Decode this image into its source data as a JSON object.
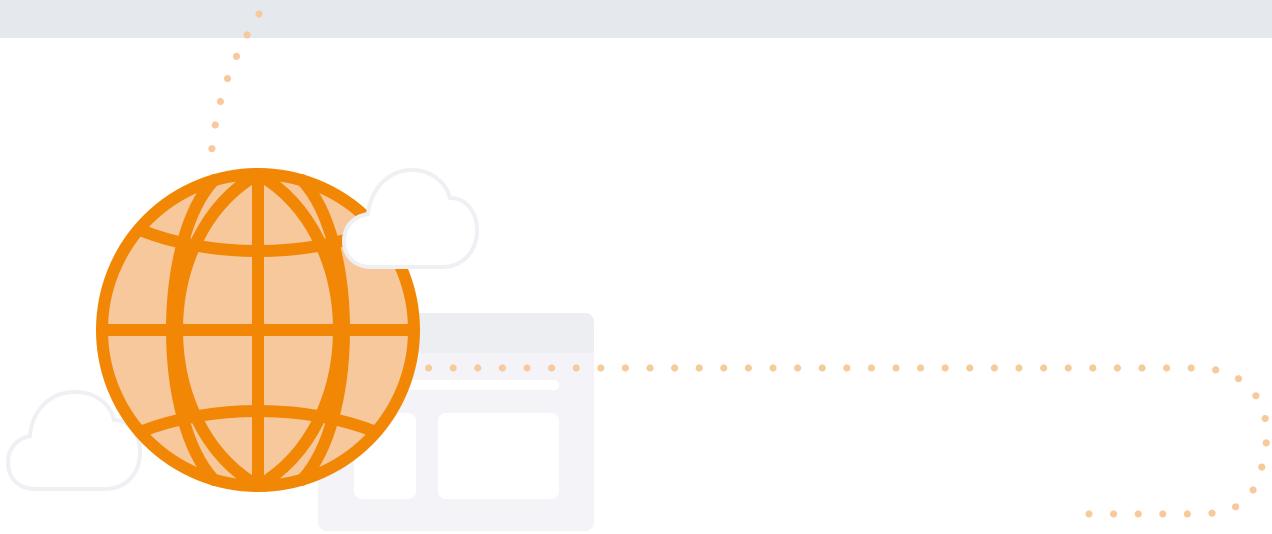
{
  "colors": {
    "top_band": "#e5e9ee",
    "page_background": "#ffffff",
    "dotted_path": "#f8c99b",
    "globe_stroke": "#f28705",
    "globe_fill": "#f7c89b",
    "cloud_fill": "#ffffff",
    "cloud_stroke": "#eef0f4",
    "window_panel": "#f4f4f8",
    "window_header": "#eceef2",
    "window_inner": "#ffffff"
  },
  "icons": {
    "globe": "globe-icon",
    "cloud_top": "cloud-icon",
    "cloud_bottom": "cloud-icon",
    "browser_window": "browser-window-icon"
  }
}
